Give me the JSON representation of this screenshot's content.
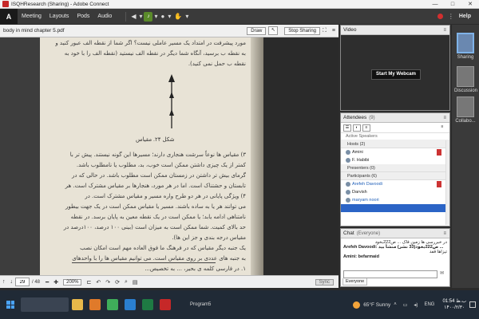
{
  "window": {
    "title": "ISQHResearch (Sharing) - Adobe Connect",
    "min": "—",
    "max": "□",
    "close": "✕"
  },
  "menubar": {
    "logo": "A",
    "items": [
      "Meeting",
      "Layouts",
      "Pods",
      "Audio"
    ],
    "help": "Help"
  },
  "share": {
    "doc_title": "body in mind chapter 5.pdf",
    "draw_label": "Draw",
    "stop_sharing_label": "Stop Sharing",
    "page_current": "29",
    "page_total": "/ 48",
    "zoom": "200%",
    "sync_label": "Sync"
  },
  "page_text": {
    "lines_top": [
      "مورد پیشرفت در امتداد یک مسیر عاملی نیست؟ اگر شما از نقطه الف عبور کنید و",
      "به نقطه ب برسید، آنگاه شما دیگر در نقطه الف نیستید (نقطه الف را با خود به",
      "نقطه ب حمل نمی کنید)."
    ],
    "caption": "شکل ۲۴. مقیاس",
    "lines_body": [
      "۳) مقیاس ها نوعاً سرشت هنجاری دارند؛ مسیرها این گونه نیستند. پیش تر با",
      "کمتر از یک چیزی داشتن ممکن است خوب، بد، مطلوب یا نامطلوب باشد.",
      "گرمای بیش تر داشتن در زمستان ممکن است مطلوب باشد. در حالی که در",
      "تابستان و حشتناک است. اما در هر مورد، هنجارها بر مقیاس مشترک است. هر",
      "۴) ویژگی پایانی در هر دو طرح واره مسیر و مقیاس مشترک است. در",
      "می توانند هر یا به ساده باشند. مسیر یا مقیاس ممکن است در یک جهت بیطور",
      "نامتناهی ادامه یابد؛ یا ممکن است در یک نقطه معین به پایان برسد. در نقطه",
      "حد بالای کمیت. شما ممکن است به میزان است (بینی ۱۰۰ درصد، ۱۰۰درصد در",
      "مقیاس درجه بندی و جز این ها).",
      "یک جنبه دیگر مقیاس که در فرهنگ ما فوق العاده مهم است امکان نصب",
      "به جنبه های عددی بر روی مقیاس است. می توانیم مقیاس ها را با واحدهای",
      "ای عددی سرو کار پیدا کنیم..."
    ],
    "footer": "۱. در فارسی کلمه ی بحیر، ... به تخصیص..."
  },
  "video": {
    "title": "Video",
    "webcam_label": "Start My Webcam"
  },
  "attendees": {
    "title": "Attendees",
    "count": "(9)",
    "active_speakers": "Active Speakers",
    "hosts_label": "Hosts (2)",
    "hosts": [
      "Amini",
      "F. Habibi"
    ],
    "presenters_label": "Presenters (0)",
    "participants_label": "Participants (6)",
    "participants": [
      "Arefeh Davoodi",
      "Darvish",
      "maryam noori",
      ""
    ]
  },
  "chat": {
    "title": "Chat",
    "scope": "(Everyone)",
    "first_line": "در خبررسی ها زمین فاک ... ص222بخود",
    "sender_line": "Arefeh Davoodi: ص222بخود(33 نشر) منشأ بید ...",
    "second_line": "تیزاها قفد",
    "third_line": "Amini: befarmaid",
    "tab_label": "Everyone"
  },
  "layouts": {
    "items": [
      "Sharing",
      "Discussion",
      "Collabo..."
    ]
  },
  "taskbar": {
    "search_text": "",
    "program_label": "Program5",
    "weather": "65°F  Sunny",
    "lang": "ENG",
    "time": "ب.ظ 01:54",
    "date": "۱۴۰۰/۲/۳۰"
  }
}
